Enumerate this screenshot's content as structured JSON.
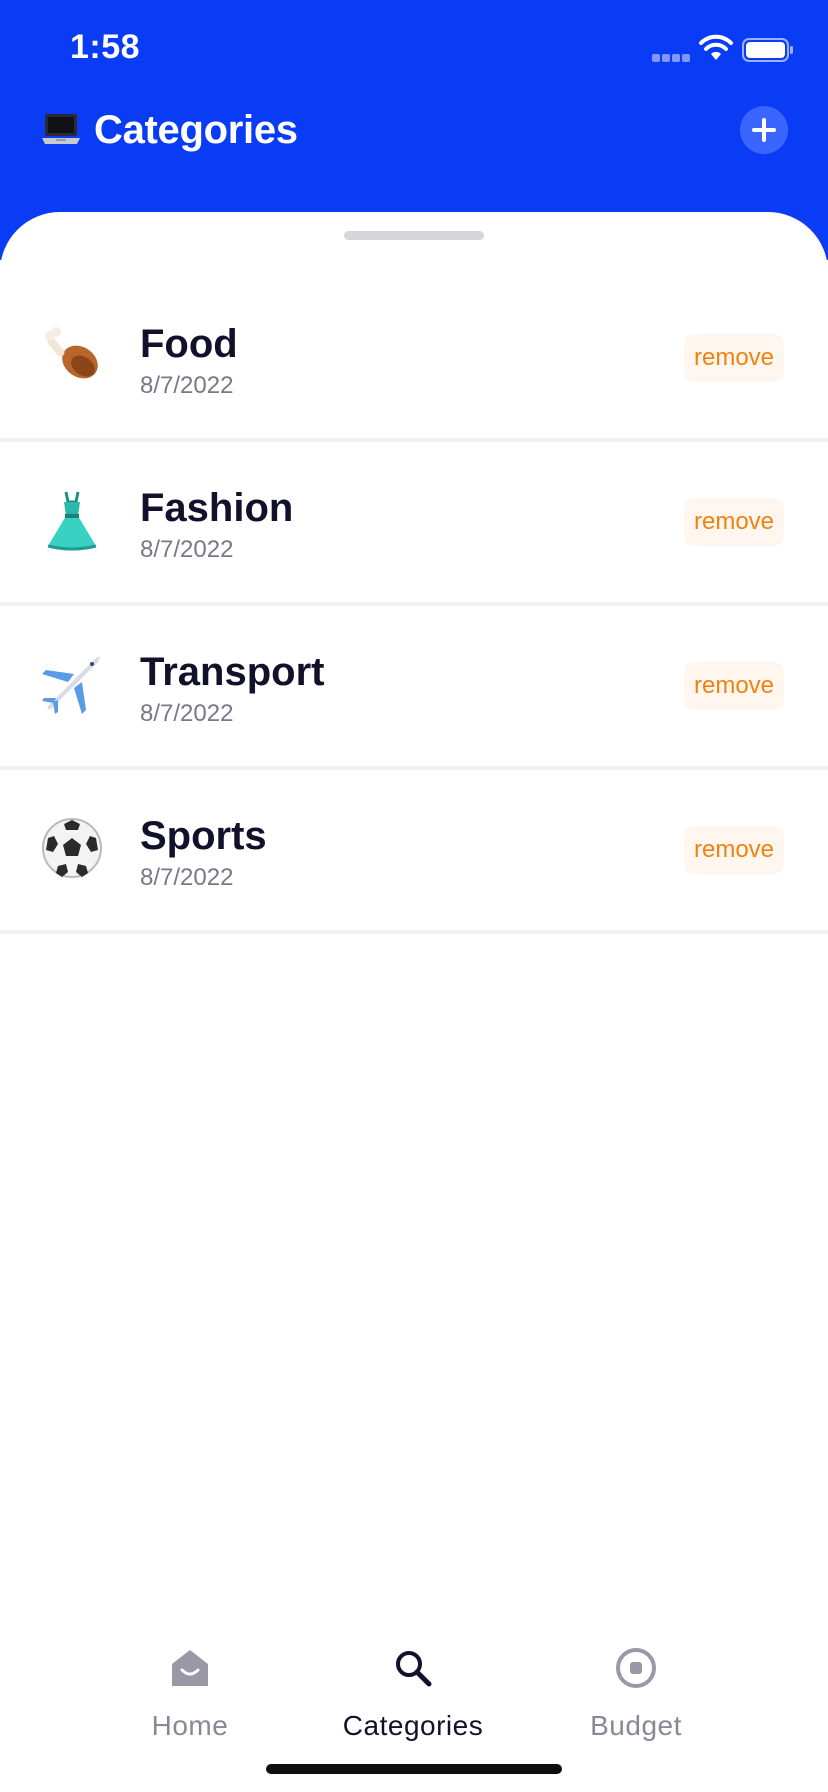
{
  "status_bar": {
    "time": "1:58"
  },
  "header": {
    "emoji": "💻",
    "title": "Categories",
    "background_color": "#0a3cf5"
  },
  "categories": [
    {
      "name": "Food",
      "date": "8/7/2022",
      "icon": "poultry-leg-icon",
      "action_label": "remove"
    },
    {
      "name": "Fashion",
      "date": "8/7/2022",
      "icon": "dress-icon",
      "action_label": "remove"
    },
    {
      "name": "Transport",
      "date": "8/7/2022",
      "icon": "airplane-icon",
      "action_label": "remove"
    },
    {
      "name": "Sports",
      "date": "8/7/2022",
      "icon": "soccer-ball-icon",
      "action_label": "remove"
    }
  ],
  "tab_bar": {
    "active": "Categories",
    "tabs": [
      {
        "label": "Home",
        "icon": "home-icon"
      },
      {
        "label": "Categories",
        "icon": "search-icon"
      },
      {
        "label": "Budget",
        "icon": "budget-icon"
      }
    ]
  },
  "colors": {
    "accent": "#0a3cf5",
    "remove_text": "#f0820f",
    "remove_bg": "#fff7ef",
    "text_primary": "#13102b",
    "text_secondary": "#7a7888"
  }
}
